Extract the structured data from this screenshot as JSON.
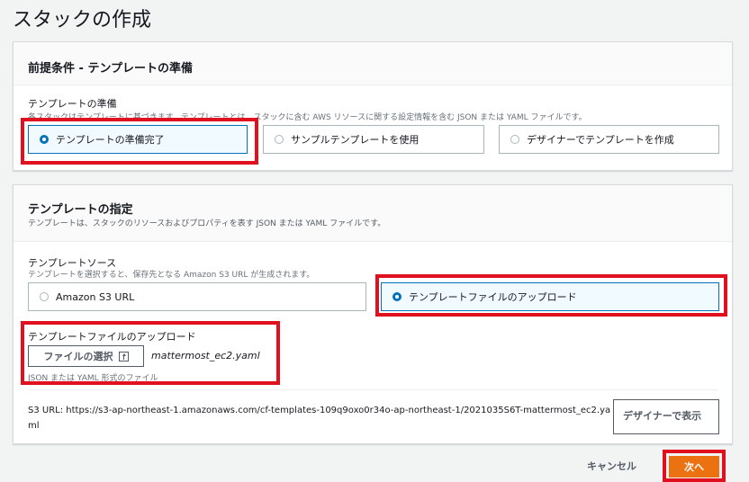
{
  "page": {
    "title": "スタックの作成"
  },
  "prereq": {
    "header": "前提条件 - テンプレートの準備",
    "label": "テンプレートの準備",
    "description": "各スタックはテンプレートに基づきます。テンプレートとは、スタックに含む AWS リソースに関する設定情報を含む JSON または YAML ファイルです。",
    "options": [
      {
        "label": "テンプレートの準備完了",
        "selected": true
      },
      {
        "label": "サンプルテンプレートを使用",
        "selected": false
      },
      {
        "label": "デザイナーでテンプレートを作成",
        "selected": false
      }
    ]
  },
  "spec": {
    "header": "テンプレートの指定",
    "description": "テンプレートは、スタックのリソースおよびプロパティを表す JSON または YAML ファイルです。",
    "source_label": "テンプレートソース",
    "source_description": "テンプレートを選択すると、保存先となる Amazon S3 URL が生成されます。",
    "source_options": [
      {
        "label": "Amazon S3 URL",
        "selected": false
      },
      {
        "label": "テンプレートファイルのアップロード",
        "selected": true
      }
    ],
    "upload_label": "テンプレートファイルのアップロード",
    "choose_file_button": "ファイルの選択",
    "file_name": "mattermost_ec2.yaml",
    "file_hint": "JSON または YAML 形式のファイル",
    "s3_url_prefix": "S3 URL:",
    "s3_url": "https://s3-ap-northeast-1.amazonaws.com/cf-templates-109q9oxo0r34o-ap-northeast-1/2021035S6T-mattermost_ec2.yaml",
    "designer_button": "デザイナーで表示"
  },
  "footer": {
    "cancel_label": "キャンセル",
    "next_label": "次へ"
  },
  "colors": {
    "accent": "#0073bb",
    "primary_button": "#ec7211",
    "highlight_box": "#e0101f"
  }
}
